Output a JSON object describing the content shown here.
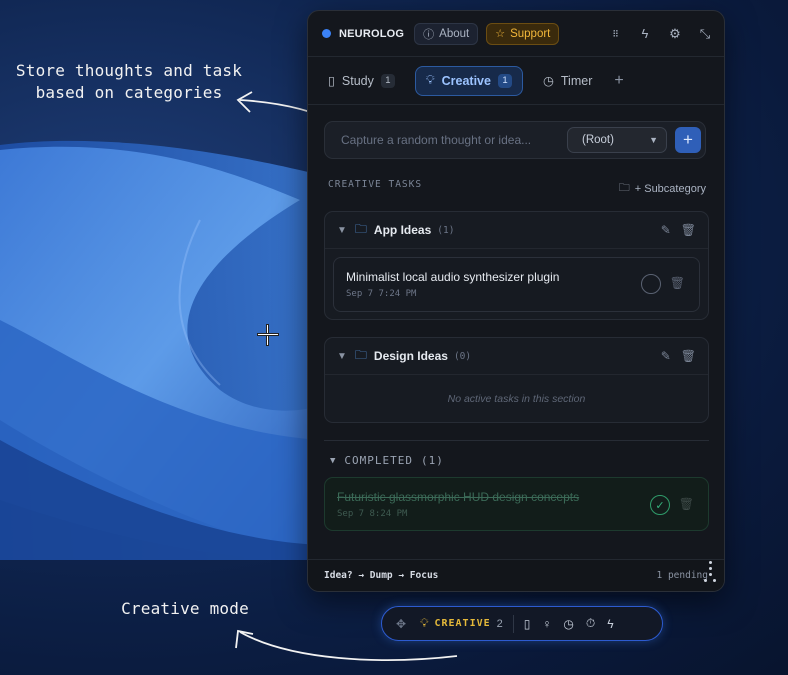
{
  "annotations": {
    "top_line1": "Store thoughts and task",
    "top_line2": "based on categories",
    "bottom": "Creative mode"
  },
  "header": {
    "brand": "NEUROLOG",
    "about_label": "About",
    "support_label": "Support",
    "icons": [
      "grid-dots-icon",
      "lightning-icon",
      "gear-icon",
      "collapse-icon"
    ]
  },
  "tabs": [
    {
      "label": "Study",
      "badge": "1",
      "icon": "book-icon"
    },
    {
      "label": "Creative",
      "badge": "1",
      "icon": "lightbulb-icon",
      "active": true
    },
    {
      "label": "Timer",
      "icon": "clock-icon"
    }
  ],
  "capture": {
    "placeholder": "Capture a random thought or idea...",
    "category": "(Root)"
  },
  "section": {
    "label": "CREATIVE TASKS",
    "subcategory_label": "+ Subcategory"
  },
  "categories": [
    {
      "name": "App Ideas",
      "count": "(1)",
      "tasks": [
        {
          "title": "Minimalist local audio synthesizer plugin",
          "date": "Sep 7 7:24 PM"
        }
      ]
    },
    {
      "name": "Design Ideas",
      "count": "(0)",
      "empty_text": "No active tasks in this section"
    }
  ],
  "completed": {
    "label": "COMPLETED",
    "count": "(1)",
    "tasks": [
      {
        "title": "Futuristic glassmorphic HUD design concepts",
        "date": "Sep 7 8:24 PM"
      }
    ]
  },
  "footer": {
    "flow": "Idea? → Dump → Focus",
    "pending": "1 pending"
  },
  "dock": {
    "mode": "CREATIVE",
    "count": "2",
    "icons": [
      "move-icon",
      "book-icon",
      "lightbulb-icon",
      "clock-icon",
      "stopwatch-icon",
      "lightning-icon"
    ],
    "accent": "#e5b93a"
  },
  "colors": {
    "accent_blue": "#3b82f6",
    "support_gold": "#f2b73a",
    "done_green": "#36b37e"
  }
}
